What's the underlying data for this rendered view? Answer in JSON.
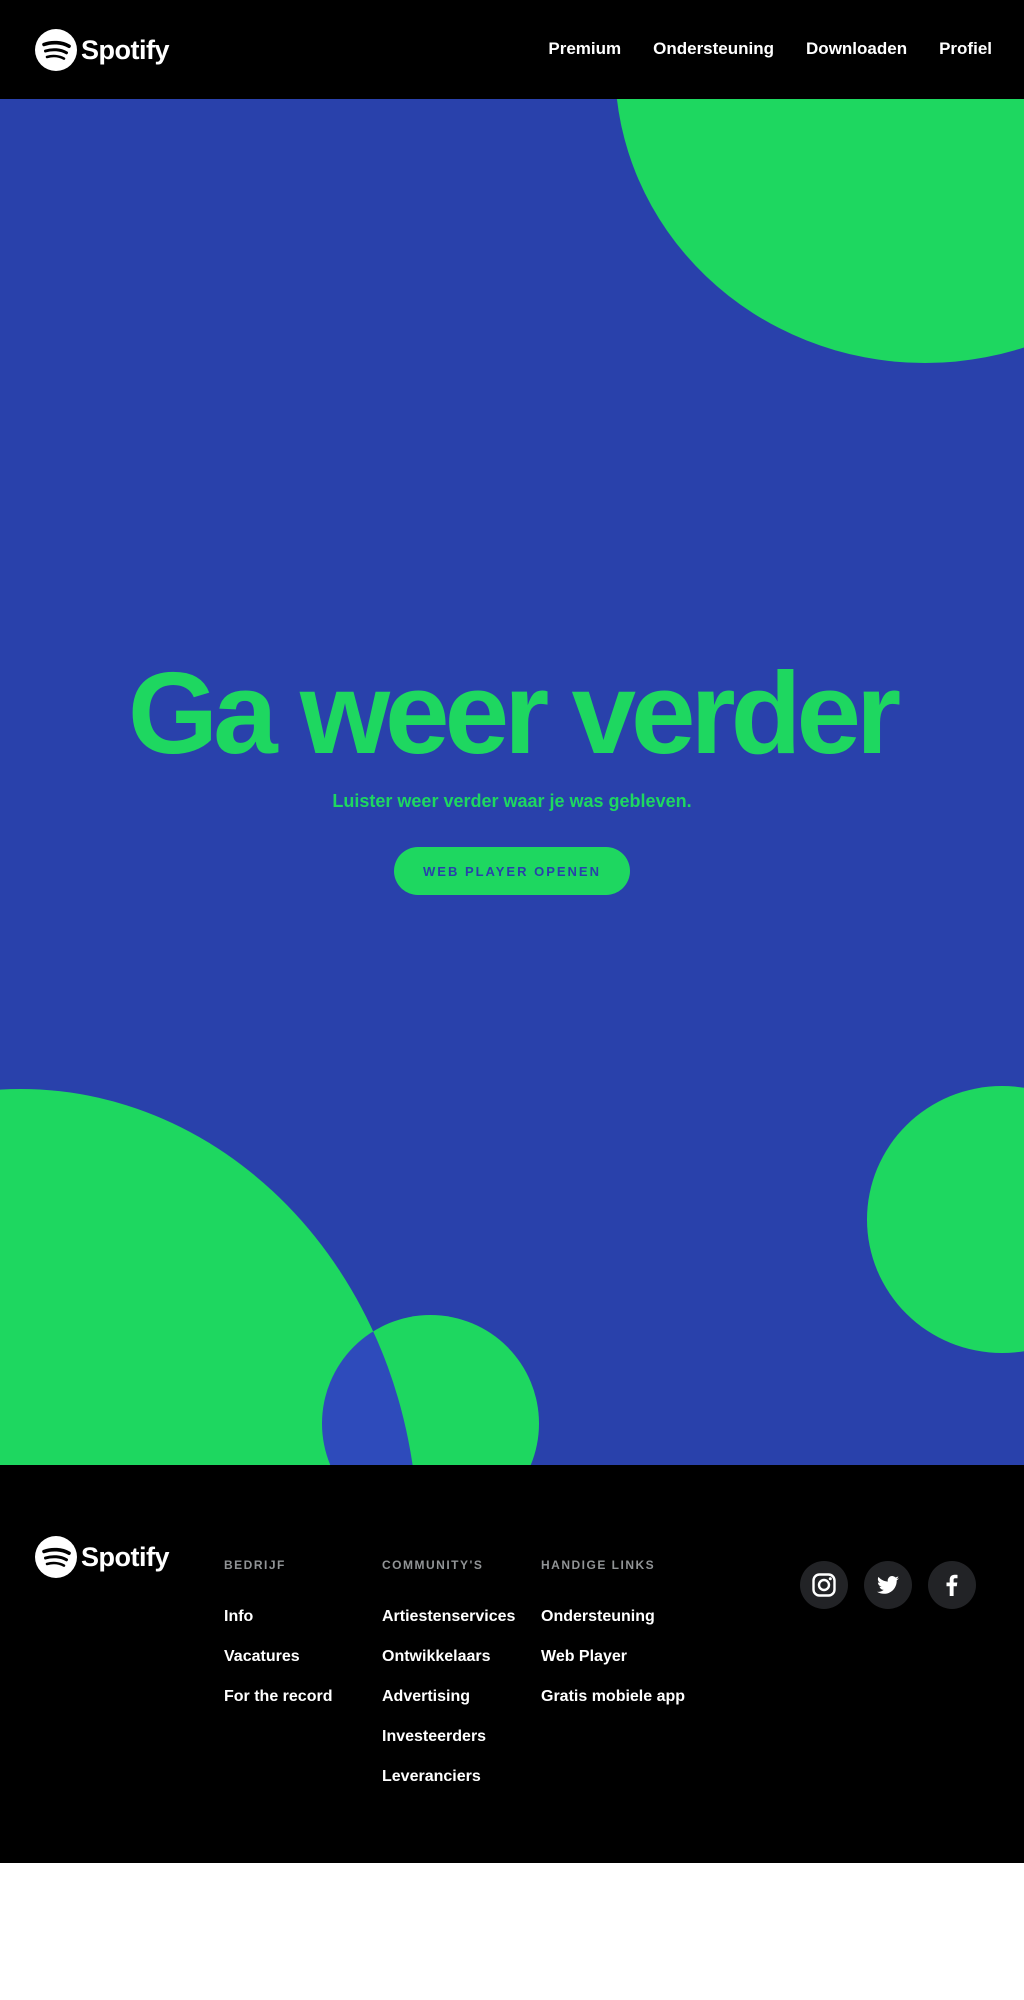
{
  "brand": {
    "name": "Spotify"
  },
  "nav": {
    "items": [
      {
        "label": "Premium"
      },
      {
        "label": "Ondersteuning"
      },
      {
        "label": "Downloaden"
      },
      {
        "label": "Profiel"
      }
    ]
  },
  "hero": {
    "title": "Ga weer verder",
    "subtitle": "Luister weer verder waar je was gebleven.",
    "cta_label": "WEB PLAYER OPENEN"
  },
  "footer": {
    "columns": [
      {
        "heading": "BEDRIJF",
        "links": [
          "Info",
          "Vacatures",
          "For the record"
        ]
      },
      {
        "heading": "COMMUNITY'S",
        "links": [
          "Artiestenservices",
          "Ontwikkelaars",
          "Advertising",
          "Investeerders",
          "Leveranciers"
        ]
      },
      {
        "heading": "HANDIGE LINKS",
        "links": [
          "Ondersteuning",
          "Web Player",
          "Gratis mobiele app"
        ]
      }
    ],
    "social": [
      {
        "icon": "instagram-icon"
      },
      {
        "icon": "twitter-icon"
      },
      {
        "icon": "facebook-icon"
      }
    ]
  },
  "colors": {
    "header_bg": "#000000",
    "hero_bg": "#2941ab",
    "accent_green": "#1ed760",
    "footer_heading": "#919496",
    "social_bg": "#222326"
  }
}
